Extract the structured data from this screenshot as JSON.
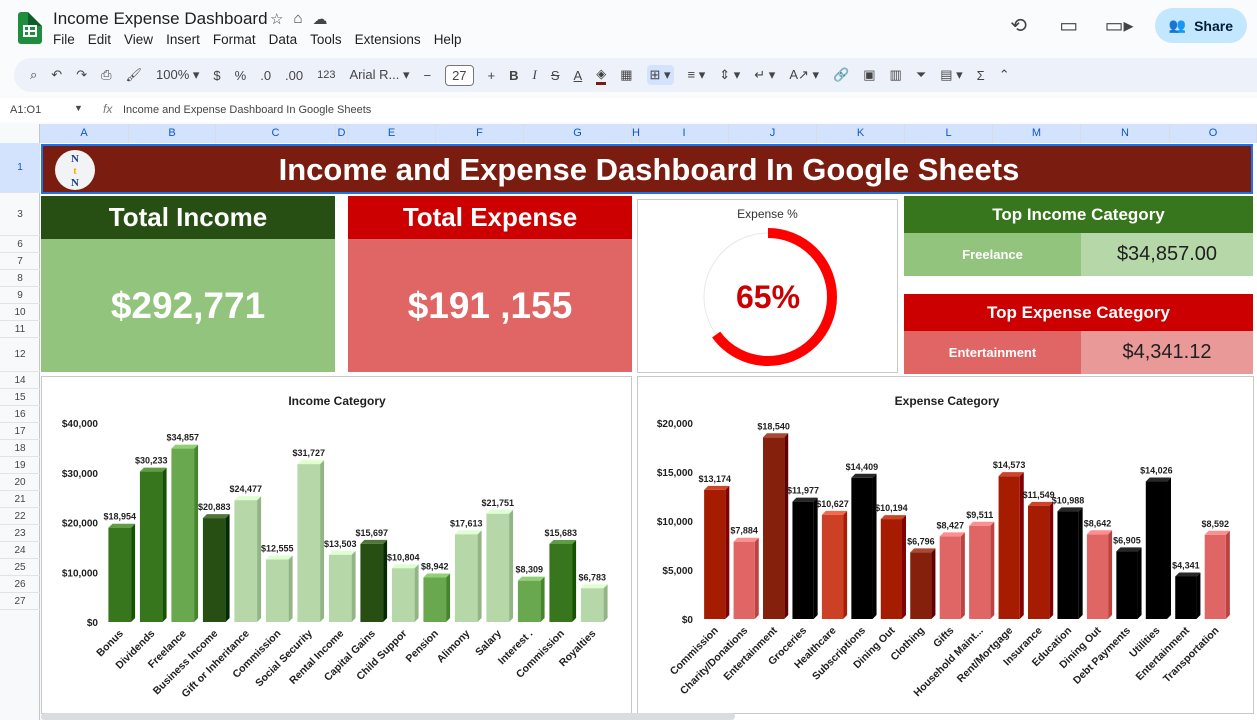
{
  "app": {
    "doc_title": "Income Expense Dashboard",
    "menu": [
      "File",
      "Edit",
      "View",
      "Insert",
      "Format",
      "Data",
      "Tools",
      "Extensions",
      "Help"
    ],
    "share_label": "Share",
    "colors": {
      "sheets_green": "#1e8e3e",
      "share_bg": "#c2e7ff"
    }
  },
  "toolbar": {
    "zoom": "100%",
    "currency": "$",
    "percent": "%",
    "dec_decrease": ".0",
    "dec_increase": ".00",
    "number_format": "123",
    "font_name": "Arial R...",
    "font_size": "27",
    "minus": "−",
    "plus": "+",
    "bold": "B",
    "italic": "I",
    "strike": "S",
    "text_color": "A",
    "sum": "Σ"
  },
  "formula_bar": {
    "name_box": "A1:O1",
    "fx": "fx",
    "content": "Income and Expense Dashboard In Google Sheets"
  },
  "grid": {
    "columns": [
      "A",
      "B",
      "C",
      "D",
      "E",
      "F",
      "G",
      "H",
      "I",
      "J",
      "K",
      "L",
      "M",
      "N",
      "O"
    ],
    "rows": [
      "1",
      "3",
      "6",
      "7",
      "8",
      "9",
      "10",
      "11",
      "12",
      "14",
      "15",
      "16",
      "17",
      "18",
      "19",
      "20",
      "21",
      "22",
      "23",
      "24",
      "25",
      "26",
      "27"
    ]
  },
  "dashboard": {
    "title": "Income and Expense Dashboard In Google Sheets",
    "logo_text": [
      "N",
      "t",
      "N"
    ],
    "total_income": {
      "label": "Total Income",
      "value": "$292,771"
    },
    "total_expense": {
      "label": "Total Expense",
      "value": "$191 ,155"
    },
    "expense_pct": {
      "label": "Expense %",
      "value": "65%",
      "fraction": 0.65
    },
    "top_income": {
      "label": "Top Income Category",
      "category": "Freelance",
      "amount": "$34,857.00"
    },
    "top_expense": {
      "label": "Top Expense Category",
      "category": "Entertainment",
      "amount": "$4,341.12"
    },
    "colors": {
      "banner": "#7a1c0f",
      "income_dark": "#274e13",
      "income_light": "#93c47d",
      "expense_dark": "#cc0000",
      "expense_light": "#e06666",
      "top_income_head": "#38761d",
      "top_income_cat": "#93c47d",
      "top_income_val": "#b6d7a8",
      "top_expense_head": "#cc0000",
      "top_expense_cat": "#e06666",
      "top_expense_val": "#ea9999",
      "donut": "#ff0000",
      "donut_text": "#cc0000"
    }
  },
  "chart_data": [
    {
      "type": "bar",
      "title": "Income Category",
      "categories": [
        "Bonus",
        "Dividends",
        "Freelance",
        "Business Income",
        "Gift or Inheritance",
        "Commission",
        "Social Security",
        "Rental Income",
        "Capital Gains",
        "Child Suppor",
        "Pension",
        "Alimony",
        "Salary",
        "Interest .",
        "Commission",
        "Royalties"
      ],
      "values": [
        18954,
        30233,
        34857,
        20883,
        24477,
        12555,
        31727,
        13503,
        15697,
        10804,
        8942,
        17613,
        21751,
        8309,
        15683,
        6783
      ],
      "data_labels": [
        "$18,954",
        "$30,233",
        "$34,857",
        "$20,883",
        "$24,477",
        "$12,555",
        "$31,727",
        "$13,503",
        "$15,697",
        "$10,804",
        "$8,942",
        "$17,613",
        "$21,751",
        "$8,309",
        "$15,683",
        "$6,783"
      ],
      "bar_colors": [
        "#38761d",
        "#38761d",
        "#6aa84f",
        "#274e13",
        "#b6d7a8",
        "#b6d7a8",
        "#b6d7a8",
        "#b6d7a8",
        "#274e13",
        "#b6d7a8",
        "#6aa84f",
        "#b6d7a8",
        "#b6d7a8",
        "#6aa84f",
        "#38761d",
        "#b6d7a8"
      ],
      "yticks": [
        "$0",
        "$10,000",
        "$20,000",
        "$30,000",
        "$40,000"
      ],
      "ylim": [
        0,
        40000
      ],
      "grid": false,
      "legend": "none"
    },
    {
      "type": "bar",
      "title": "Expense Category",
      "categories": [
        "Commission",
        "Charity/Donations",
        "Entertainment",
        "Groceries",
        "Healthcare",
        "Subscriptions",
        "Dining Out",
        "Clothing",
        "Gifts",
        "Household Maint...",
        "Rent/Mortgage",
        "Insurance",
        "Education",
        "Dining Out",
        "Debt Payments",
        "Utilities",
        "Entertainment",
        "Transportation"
      ],
      "values": [
        13174,
        7884,
        18540,
        11977,
        10627,
        14409,
        10194,
        6796,
        8427,
        9511,
        14573,
        11549,
        10988,
        8642,
        6905,
        14026,
        4341,
        8592
      ],
      "data_labels": [
        "$13,174",
        "$7,884",
        "$18,540",
        "$11,977",
        "$10,627",
        "$14,409",
        "$10,194",
        "$6,796",
        "$8,427",
        "$9,511",
        "$14,573",
        "$11,549",
        "$10,988",
        "$8,642",
        "$6,905",
        "$14,026",
        "$4,341",
        "$8,592"
      ],
      "bar_colors": [
        "#a61c00",
        "#e06666",
        "#85200c",
        "#000000",
        "#cc4125",
        "#000000",
        "#a61c00",
        "#85200c",
        "#e06666",
        "#e06666",
        "#a61c00",
        "#a61c00",
        "#000000",
        "#e06666",
        "#000000",
        "#000000",
        "#000000",
        "#e06666"
      ],
      "yticks": [
        "$0",
        "$5,000",
        "$10,000",
        "$15,000",
        "$20,000"
      ],
      "ylim": [
        0,
        20000
      ],
      "grid": false,
      "legend": "none"
    }
  ]
}
